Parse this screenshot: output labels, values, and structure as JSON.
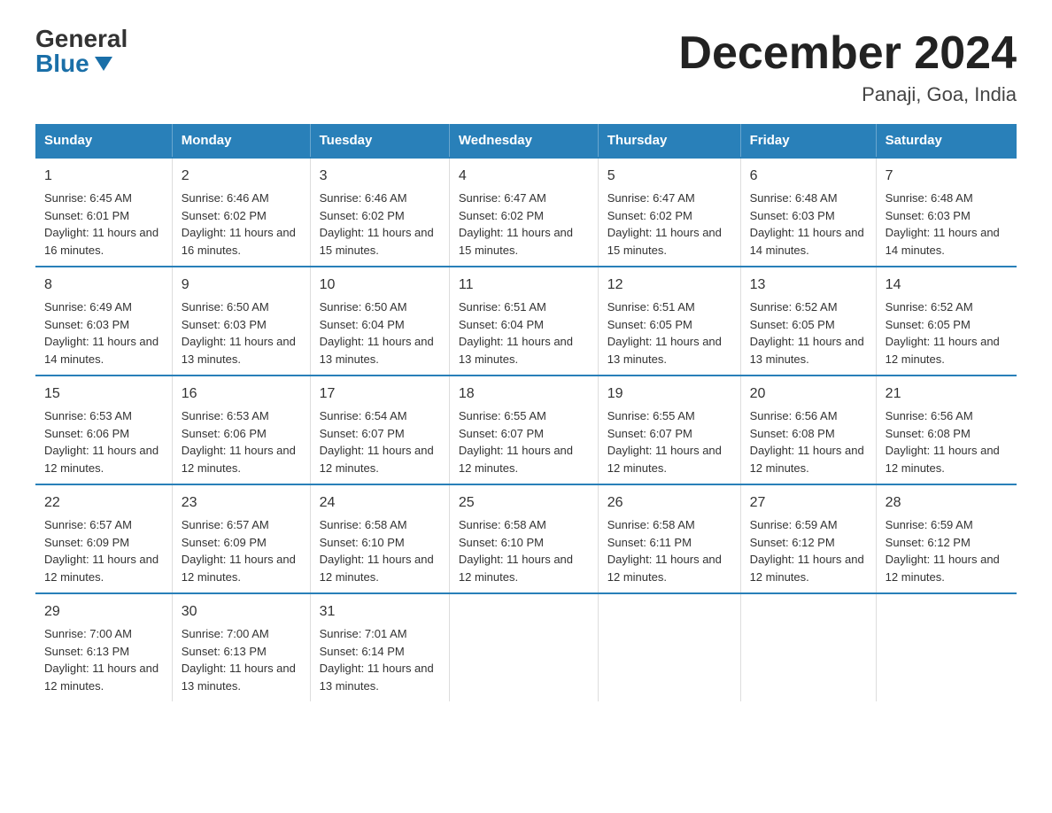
{
  "header": {
    "logo_general": "General",
    "logo_blue": "Blue",
    "main_title": "December 2024",
    "subtitle": "Panaji, Goa, India"
  },
  "days_of_week": [
    "Sunday",
    "Monday",
    "Tuesday",
    "Wednesday",
    "Thursday",
    "Friday",
    "Saturday"
  ],
  "weeks": [
    [
      {
        "day": "1",
        "sunrise": "6:45 AM",
        "sunset": "6:01 PM",
        "daylight": "11 hours and 16 minutes."
      },
      {
        "day": "2",
        "sunrise": "6:46 AM",
        "sunset": "6:02 PM",
        "daylight": "11 hours and 16 minutes."
      },
      {
        "day": "3",
        "sunrise": "6:46 AM",
        "sunset": "6:02 PM",
        "daylight": "11 hours and 15 minutes."
      },
      {
        "day": "4",
        "sunrise": "6:47 AM",
        "sunset": "6:02 PM",
        "daylight": "11 hours and 15 minutes."
      },
      {
        "day": "5",
        "sunrise": "6:47 AM",
        "sunset": "6:02 PM",
        "daylight": "11 hours and 15 minutes."
      },
      {
        "day": "6",
        "sunrise": "6:48 AM",
        "sunset": "6:03 PM",
        "daylight": "11 hours and 14 minutes."
      },
      {
        "day": "7",
        "sunrise": "6:48 AM",
        "sunset": "6:03 PM",
        "daylight": "11 hours and 14 minutes."
      }
    ],
    [
      {
        "day": "8",
        "sunrise": "6:49 AM",
        "sunset": "6:03 PM",
        "daylight": "11 hours and 14 minutes."
      },
      {
        "day": "9",
        "sunrise": "6:50 AM",
        "sunset": "6:03 PM",
        "daylight": "11 hours and 13 minutes."
      },
      {
        "day": "10",
        "sunrise": "6:50 AM",
        "sunset": "6:04 PM",
        "daylight": "11 hours and 13 minutes."
      },
      {
        "day": "11",
        "sunrise": "6:51 AM",
        "sunset": "6:04 PM",
        "daylight": "11 hours and 13 minutes."
      },
      {
        "day": "12",
        "sunrise": "6:51 AM",
        "sunset": "6:05 PM",
        "daylight": "11 hours and 13 minutes."
      },
      {
        "day": "13",
        "sunrise": "6:52 AM",
        "sunset": "6:05 PM",
        "daylight": "11 hours and 13 minutes."
      },
      {
        "day": "14",
        "sunrise": "6:52 AM",
        "sunset": "6:05 PM",
        "daylight": "11 hours and 12 minutes."
      }
    ],
    [
      {
        "day": "15",
        "sunrise": "6:53 AM",
        "sunset": "6:06 PM",
        "daylight": "11 hours and 12 minutes."
      },
      {
        "day": "16",
        "sunrise": "6:53 AM",
        "sunset": "6:06 PM",
        "daylight": "11 hours and 12 minutes."
      },
      {
        "day": "17",
        "sunrise": "6:54 AM",
        "sunset": "6:07 PM",
        "daylight": "11 hours and 12 minutes."
      },
      {
        "day": "18",
        "sunrise": "6:55 AM",
        "sunset": "6:07 PM",
        "daylight": "11 hours and 12 minutes."
      },
      {
        "day": "19",
        "sunrise": "6:55 AM",
        "sunset": "6:07 PM",
        "daylight": "11 hours and 12 minutes."
      },
      {
        "day": "20",
        "sunrise": "6:56 AM",
        "sunset": "6:08 PM",
        "daylight": "11 hours and 12 minutes."
      },
      {
        "day": "21",
        "sunrise": "6:56 AM",
        "sunset": "6:08 PM",
        "daylight": "11 hours and 12 minutes."
      }
    ],
    [
      {
        "day": "22",
        "sunrise": "6:57 AM",
        "sunset": "6:09 PM",
        "daylight": "11 hours and 12 minutes."
      },
      {
        "day": "23",
        "sunrise": "6:57 AM",
        "sunset": "6:09 PM",
        "daylight": "11 hours and 12 minutes."
      },
      {
        "day": "24",
        "sunrise": "6:58 AM",
        "sunset": "6:10 PM",
        "daylight": "11 hours and 12 minutes."
      },
      {
        "day": "25",
        "sunrise": "6:58 AM",
        "sunset": "6:10 PM",
        "daylight": "11 hours and 12 minutes."
      },
      {
        "day": "26",
        "sunrise": "6:58 AM",
        "sunset": "6:11 PM",
        "daylight": "11 hours and 12 minutes."
      },
      {
        "day": "27",
        "sunrise": "6:59 AM",
        "sunset": "6:12 PM",
        "daylight": "11 hours and 12 minutes."
      },
      {
        "day": "28",
        "sunrise": "6:59 AM",
        "sunset": "6:12 PM",
        "daylight": "11 hours and 12 minutes."
      }
    ],
    [
      {
        "day": "29",
        "sunrise": "7:00 AM",
        "sunset": "6:13 PM",
        "daylight": "11 hours and 12 minutes."
      },
      {
        "day": "30",
        "sunrise": "7:00 AM",
        "sunset": "6:13 PM",
        "daylight": "11 hours and 13 minutes."
      },
      {
        "day": "31",
        "sunrise": "7:01 AM",
        "sunset": "6:14 PM",
        "daylight": "11 hours and 13 minutes."
      },
      null,
      null,
      null,
      null
    ]
  ]
}
